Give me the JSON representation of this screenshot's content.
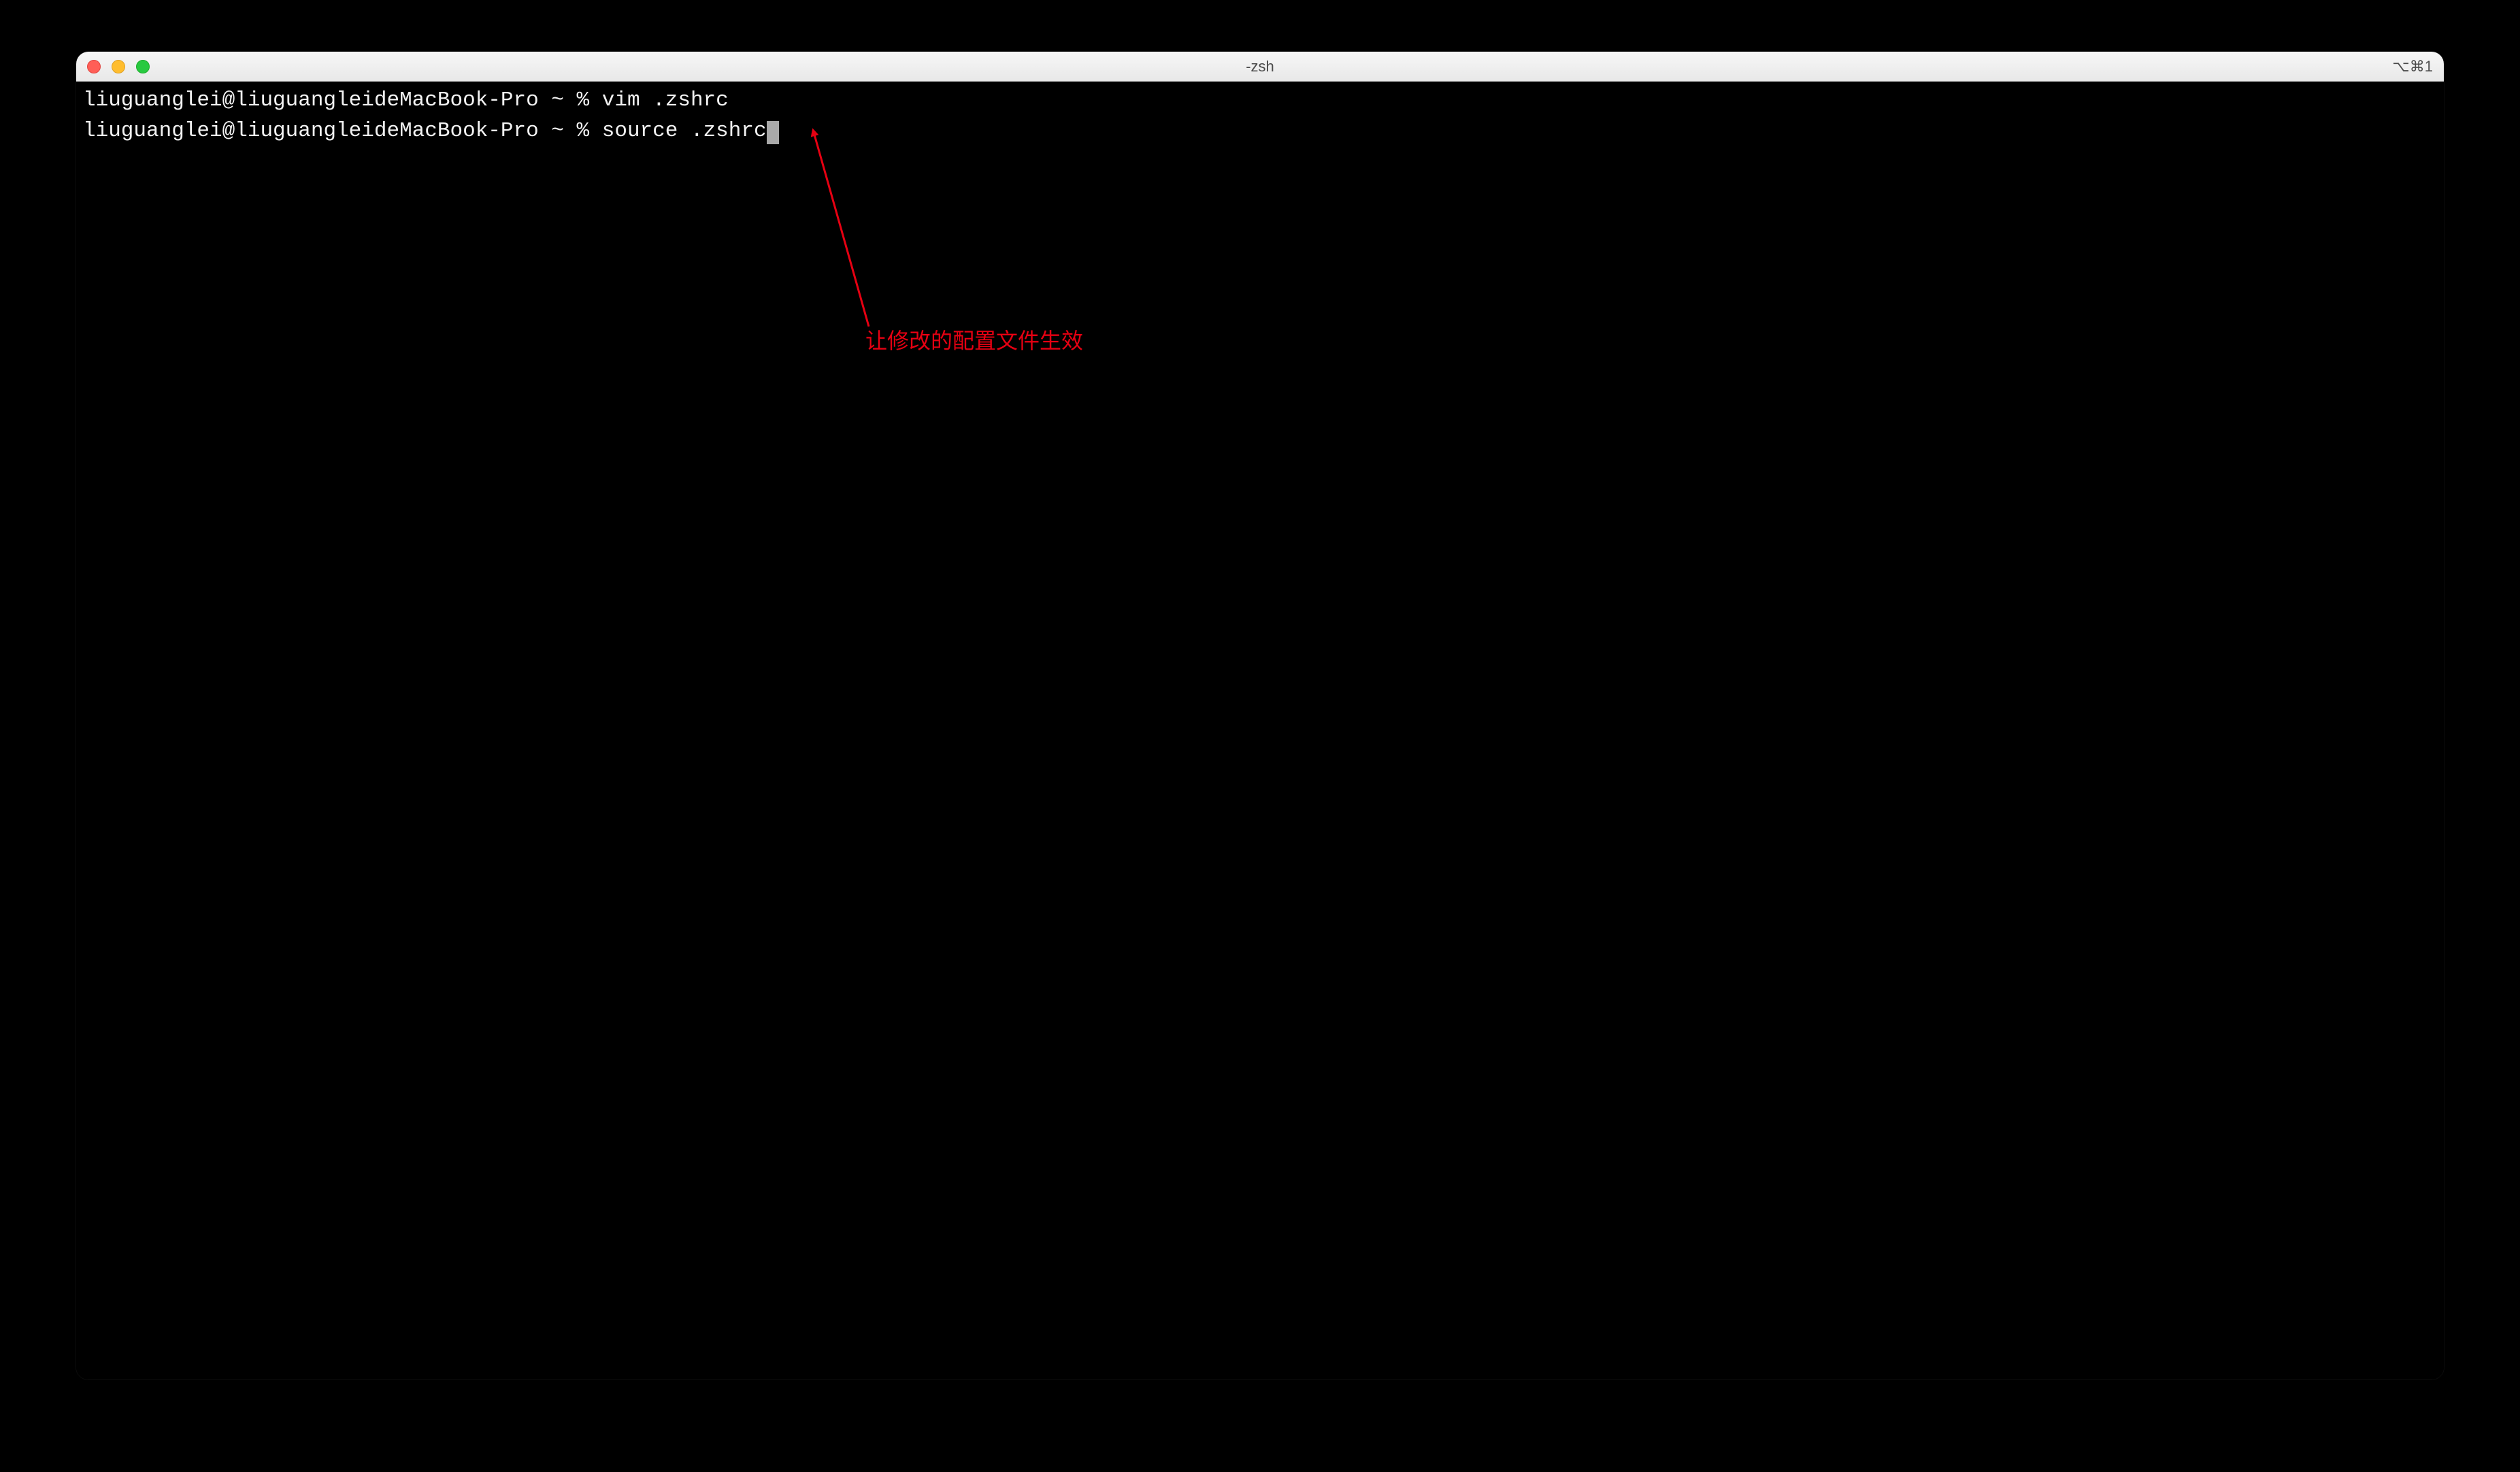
{
  "window": {
    "title": "-zsh",
    "shortcut": "⌥⌘1"
  },
  "terminal": {
    "lines": [
      {
        "prompt": "liuguanglei@liuguangleideMacBook-Pro ~ % ",
        "command": "vim .zshrc"
      },
      {
        "prompt": "liuguanglei@liuguangleideMacBook-Pro ~ % ",
        "command": "source .zshrc"
      }
    ]
  },
  "annotation": {
    "text": "让修改的配置文件生效",
    "color": "#e60012"
  }
}
